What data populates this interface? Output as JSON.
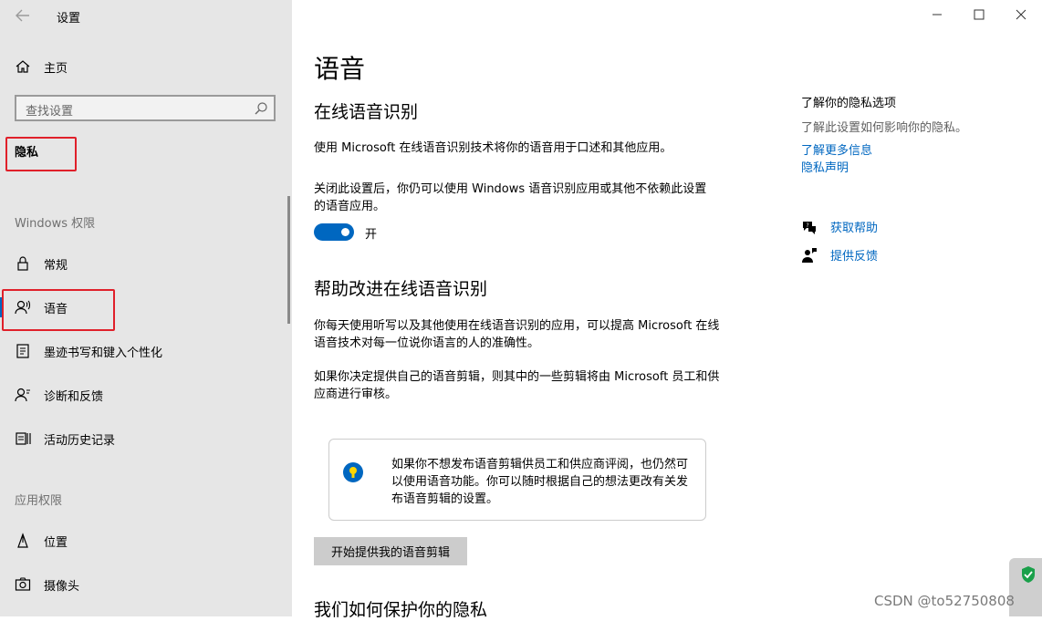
{
  "window": {
    "title": "设置"
  },
  "sidebar": {
    "home_label": "主页",
    "search_placeholder": "查找设置",
    "category": "隐私",
    "section_windows": "Windows 权限",
    "section_app": "应用权限",
    "items": [
      {
        "label": "常规",
        "icon": "lock-icon"
      },
      {
        "label": "语音",
        "icon": "speech-icon",
        "selected": true
      },
      {
        "label": "墨迹书写和键入个性化",
        "icon": "ink-icon"
      },
      {
        "label": "诊断和反馈",
        "icon": "diagnostics-icon"
      },
      {
        "label": "活动历史记录",
        "icon": "activity-history-icon"
      },
      {
        "label": "位置",
        "icon": "location-icon"
      },
      {
        "label": "摄像头",
        "icon": "camera-icon"
      }
    ]
  },
  "main": {
    "title": "语音",
    "section1": {
      "heading": "在线语音识别",
      "desc": "使用 Microsoft 在线语音识别技术将你的语音用于口述和其他应用。",
      "note": "关闭此设置后，你仍可以使用 Windows 语音识别应用或其他不依赖此设置的语音应用。",
      "toggle_state": "开"
    },
    "section2": {
      "heading": "帮助改进在线语音识别",
      "p1": "你每天使用听写以及其他使用在线语音识别的应用，可以提高 Microsoft 在线语音技术对每一位说你语言的人的准确性。",
      "p2": "如果你决定提供自己的语音剪辑，则其中的一些剪辑将由 Microsoft 员工和供应商进行审核。",
      "info_text": "如果你不想发布语音剪辑供员工和供应商评阅，也仍然可以使用语音功能。你可以随时根据自己的想法更改有关发布语音剪辑的设置。",
      "button_label": "开始提供我的语音剪辑"
    },
    "section3": {
      "heading": "我们如何保护你的隐私"
    }
  },
  "right": {
    "title": "了解你的隐私选项",
    "subtitle": "了解此设置如何影响你的隐私。",
    "link_more": "了解更多信息",
    "link_statement": "隐私声明",
    "help_label": "获取帮助",
    "feedback_label": "提供反馈"
  },
  "watermark": "CSDN @to52750808",
  "colors": {
    "accent": "#0067c0",
    "highlight": "#e0202a",
    "sidebar_bg": "#e6e6e6"
  }
}
